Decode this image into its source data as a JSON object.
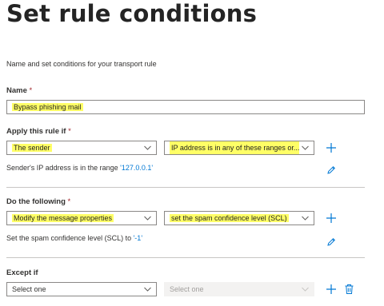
{
  "page": {
    "title": "Set rule conditions",
    "subtitle": "Name and set conditions for your transport rule"
  },
  "name": {
    "label": "Name",
    "required_mark": " *",
    "value": "Bypass phishing mail"
  },
  "apply_if": {
    "label": "Apply this rule if",
    "required_mark": " *",
    "condition": "The sender",
    "predicate": "IP address is in any of these ranges or...",
    "summary_prefix": "Sender's IP address is in the range ",
    "summary_value": "'127.0.0.1'"
  },
  "do_following": {
    "label": "Do the following",
    "required_mark": " *",
    "action": "Modify the message properties",
    "property": "set the spam confidence level (SCL)",
    "summary_prefix": "Set the spam confidence level (SCL) to ",
    "summary_value": "'-1'"
  },
  "except_if": {
    "label": "Except if",
    "condition_placeholder": "Select one",
    "predicate_placeholder": "Select one"
  },
  "icons": {
    "add": "plus-icon",
    "edit": "pencil-icon",
    "delete": "trash-icon",
    "dropdown": "chevron-down-icon"
  },
  "colors": {
    "accent": "#0078d4",
    "highlight": "#ffff66",
    "required": "#a4262c",
    "border": "#8a8886",
    "divider": "#c8c6c4"
  }
}
